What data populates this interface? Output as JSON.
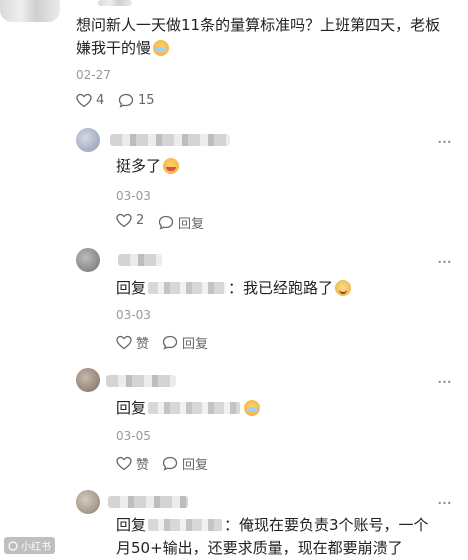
{
  "comments": [
    {
      "text_line1": "想问新人一天做11条的量算标准吗？上班第四天，老板",
      "text_line2": "嫌我干的慢",
      "date": "02-27",
      "likes": "4",
      "replies": "15"
    },
    {
      "text": "挺多了",
      "date": "03-03",
      "likes": "2",
      "reply_label": "回复"
    },
    {
      "reply_prefix": "回复",
      "text": "：我已经跑路了",
      "date": "03-03",
      "like_label": "赞",
      "reply_label": "回复"
    },
    {
      "reply_prefix": "回复",
      "date": "03-05",
      "like_label": "赞",
      "reply_label": "回复"
    },
    {
      "reply_prefix": "回复",
      "text_line1": "：俺现在要负责3个账号，一个",
      "text_line2": "月50+输出，还要求质量，现在都要崩溃了"
    }
  ],
  "more_icon": "more-horizontal-icon",
  "watermark": "小红书"
}
